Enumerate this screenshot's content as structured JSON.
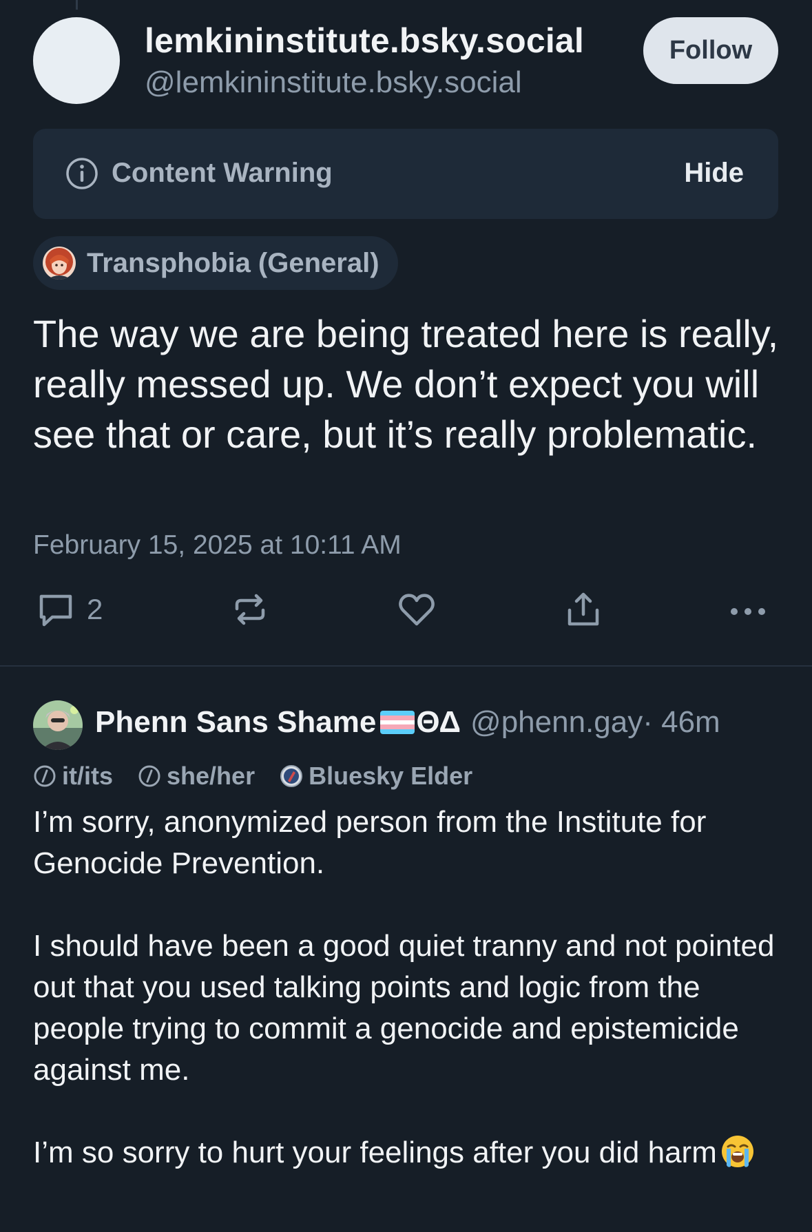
{
  "post": {
    "display_name": "lemkininstitute.bsky.social",
    "handle": "@lemkininstitute.bsky.social",
    "follow_label": "Follow",
    "content_warning": {
      "icon": "info-circle-icon",
      "label": "Content Warning",
      "hide_label": "Hide"
    },
    "label_pill": {
      "icon": "labeler-avatar",
      "text": "Transphobia (General)"
    },
    "text": "The way we are being treated here is really, really messed up. We don’t expect you will see that or care, but it’s really problematic.",
    "timestamp": "February 15, 2025 at 10:11 AM",
    "actions": {
      "reply_icon": "reply-bubble-icon",
      "reply_count": "2",
      "repost_icon": "repost-icon",
      "like_icon": "heart-icon",
      "share_icon": "share-icon",
      "more_icon": "more-dots-icon"
    }
  },
  "reply": {
    "display_name": "Phenn Sans Shame",
    "flag": "transgender-flag",
    "greek": "ΘΔ",
    "handle": "@phenn.gay",
    "time": " · 46m",
    "badges": [
      {
        "icon": "slash-circle-icon",
        "label": "it/its"
      },
      {
        "icon": "slash-circle-icon",
        "label": "she/her"
      },
      {
        "icon": "elder-badge-icon",
        "label": "Bluesky Elder"
      }
    ],
    "paragraphs": [
      "I’m sorry, anonymized person from the Institute for Genocide Prevention.",
      "I should have been a good quiet tranny and not pointed out that you used talking points and logic from the people trying to commit a genocide and epistemicide against me.",
      "I’m so sorry to hurt your feelings after you did harm"
    ],
    "trailing_emoji": "loudly-crying-face-emoji"
  },
  "colors": {
    "background": "#161e27",
    "text_primary": "#f1f3f5",
    "text_secondary": "#8e9cab",
    "panel": "#1e2a38",
    "follow_bg": "#dfe5ec"
  }
}
